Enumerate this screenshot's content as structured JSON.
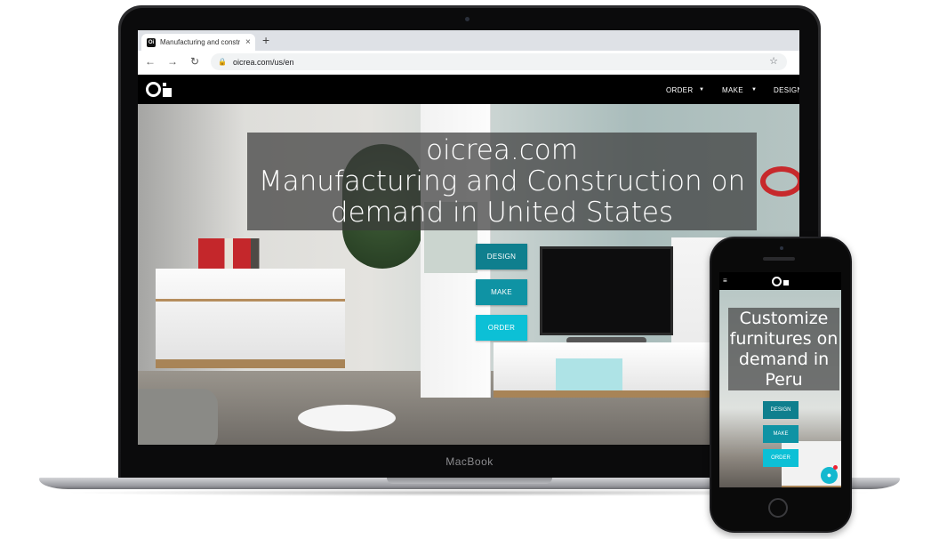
{
  "laptop": {
    "brand": "MacBook",
    "browser": {
      "tab_title": "Manufacturing and constructio",
      "tab_favicon": "Oi",
      "tab_close": "×",
      "new_tab": "+",
      "back_icon": "←",
      "forward_icon": "→",
      "reload_icon": "↻",
      "lock_icon": "🔒",
      "url": "oicrea.com/us/en",
      "star_icon": "☆"
    },
    "site": {
      "nav": [
        {
          "label": "ORDER",
          "has_caret": true
        },
        {
          "label": "MAKE",
          "has_caret": true
        },
        {
          "label": "DESIGN",
          "has_caret": false
        }
      ],
      "caret": "▼",
      "hero_lines": [
        "oicrea.com",
        "Manufacturing and Construction on",
        "demand in United States"
      ],
      "cta": {
        "design": "DESIGN",
        "make": "MAKE",
        "order": "ORDER"
      },
      "colors": {
        "design": "#0f7f8e",
        "make": "#0f93a4",
        "order": "#0cc0d6"
      }
    }
  },
  "phone": {
    "menu_icon": "≡",
    "hero_lines": [
      "Customize",
      "furnitures on",
      "demand in",
      "Peru"
    ],
    "cta": {
      "design": "DESIGN",
      "make": "MAKE",
      "order": "ORDER"
    },
    "chat_icon": "●"
  }
}
